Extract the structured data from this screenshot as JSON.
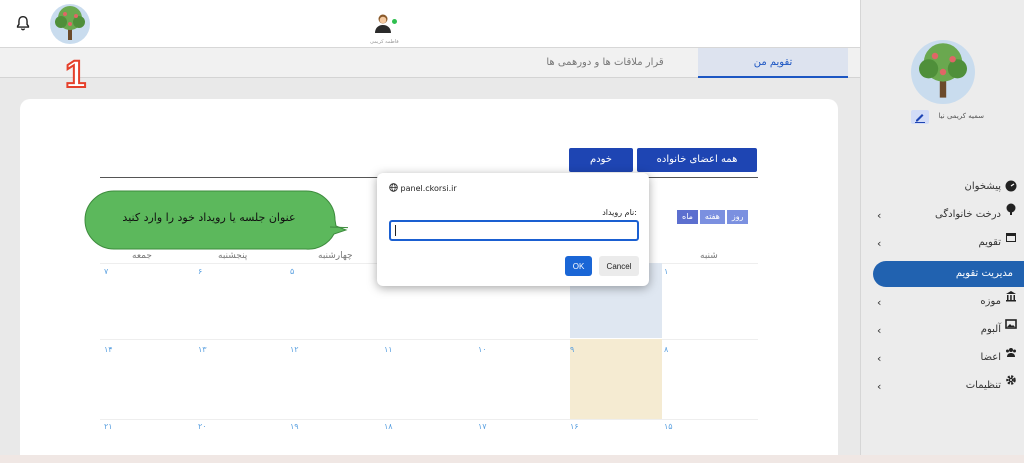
{
  "header": {
    "bell_icon": "bell-icon",
    "logo_icon": "family-tree-icon",
    "user_icon": "woman-avatar-icon",
    "user_name_small": "فاطمه کریمی"
  },
  "tabs": [
    {
      "label": "تقویم من",
      "active": true
    },
    {
      "label": "قرار ملاقات ها و دورهمی ها",
      "active": false
    }
  ],
  "step_number": "1",
  "filters": {
    "all_family": "همه اعضای خانواده",
    "self": "خودم"
  },
  "views": [
    "ماه",
    "هفته",
    "روز"
  ],
  "calendar": {
    "headers": [
      "شنبه",
      "چهارشنبه",
      "پنجشنبه",
      "جمعه"
    ],
    "row1": [
      "۱",
      "۵",
      "۶",
      "۷"
    ],
    "row2": [
      "۸",
      "۹",
      "۱۰",
      "۱۱",
      "۱۲",
      "۱۳",
      "۱۴"
    ],
    "row3": [
      "۱۵",
      "۱۶",
      "۱۷",
      "۱۸",
      "۱۹",
      "۲۰",
      "۲۱"
    ]
  },
  "dialog": {
    "origin": "panel.ckorsi.ir",
    "label": "نام رویداد:",
    "value": "",
    "ok": "OK",
    "cancel": "Cancel"
  },
  "callout": {
    "text": "عنوان جلسه  یا رویداد خود را وارد کنید"
  },
  "sidebar": {
    "user_name": "سمیه کریمی نیا",
    "items": [
      {
        "label": "پیشخوان",
        "icon": "dashboard-icon",
        "expandable": false
      },
      {
        "label": "درخت خانوادگی",
        "icon": "tree-icon",
        "expandable": true
      },
      {
        "label": "تقویم",
        "icon": "calendar-icon",
        "expandable": true
      },
      {
        "label": "مدیریت تقویم",
        "icon": "",
        "expandable": false,
        "active": true
      },
      {
        "label": "موزه",
        "icon": "museum-icon",
        "expandable": true
      },
      {
        "label": "آلبوم",
        "icon": "album-icon",
        "expandable": true
      },
      {
        "label": "اعضا",
        "icon": "users-icon",
        "expandable": true
      },
      {
        "label": "تنظیمات",
        "icon": "gear-icon",
        "expandable": true
      }
    ]
  },
  "colors": {
    "primary": "#1e45b3",
    "sidebar_active": "#2162b0",
    "callout_green": "#5cb85c",
    "step_red": "#e5402b"
  }
}
